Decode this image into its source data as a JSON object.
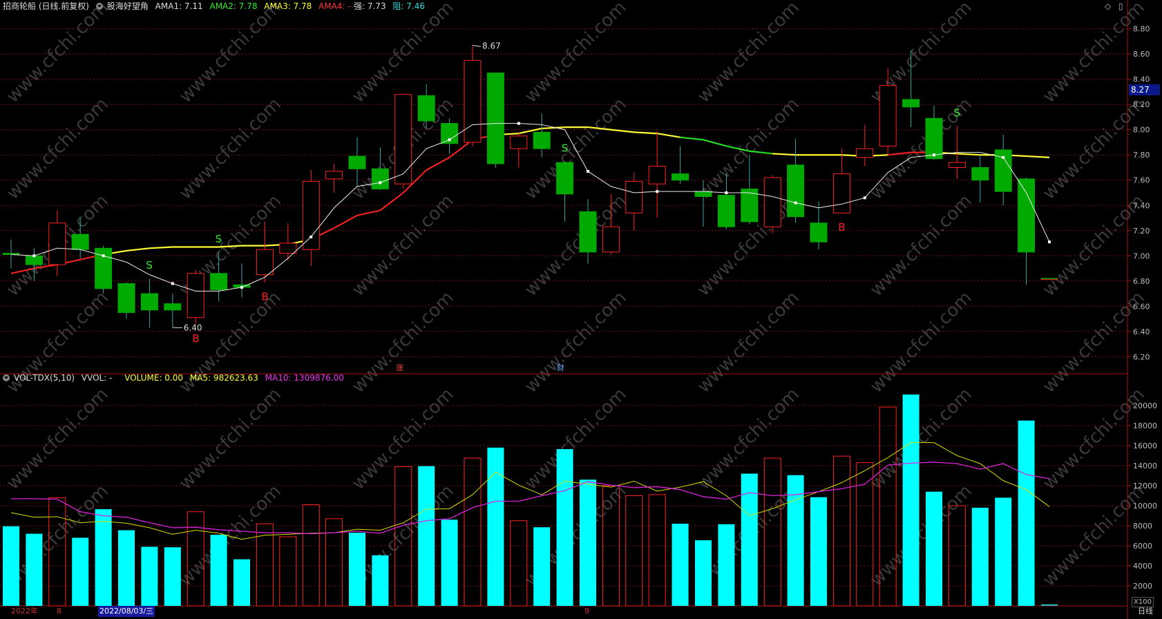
{
  "header": {
    "stock": "招商轮船 (日线.前复权)",
    "indicator": "股海好望角",
    "ama1": "AMA1: 7.11",
    "ama2": "AMA2: 7.78",
    "ama3": "AMA3: 7.78",
    "ama4": "AMA4: -",
    "strong": "强: 7.73",
    "resist": "阻: 7.46"
  },
  "vol_header": {
    "name": "VOL-TDX(5,10)",
    "vvol": "VVOL: -",
    "volume": "VOLUME: 0.00",
    "ma5": "MA5: 982623.63",
    "ma10": "MA10: 1309876.00"
  },
  "current_price_tag": "8.27",
  "high_label": "8.67",
  "low_label": "6.40",
  "markers": {
    "rise": "涨",
    "fin": "财"
  },
  "bottom": {
    "year": "2022年",
    "m8": "8",
    "date": "2022/08/03/三",
    "m9": "9",
    "daily": "日线",
    "unit": "X100"
  },
  "colors": {
    "up": "#ff2222",
    "down": "#00aa00",
    "ama_red": "#ee2222",
    "ama_green": "#22dd22",
    "ama_yellow": "#ffff33",
    "vol_up": "#00ffff",
    "ma5": "#dddd00",
    "ma10": "#dd22dd",
    "grid": "#771111",
    "axis": "#bbbbbb",
    "watermark": "#3a3a3a"
  },
  "watermark_text": "www.cfchi.com",
  "chart_data": [
    {
      "type": "candlestick",
      "y_ticks": [
        6.2,
        6.4,
        6.6,
        6.8,
        7.0,
        7.2,
        7.4,
        7.6,
        7.8,
        8.0,
        8.2,
        8.4,
        8.6,
        8.8
      ],
      "ylim": [
        6.07,
        8.93
      ],
      "candles": [
        {
          "o": 7.02,
          "h": 7.13,
          "l": 6.9,
          "c": 7.01
        },
        {
          "o": 7.0,
          "h": 7.06,
          "l": 6.8,
          "c": 6.93
        },
        {
          "o": 6.93,
          "h": 7.36,
          "l": 6.84,
          "c": 7.26
        },
        {
          "o": 7.17,
          "h": 7.3,
          "l": 6.98,
          "c": 7.05
        },
        {
          "o": 7.06,
          "h": 7.08,
          "l": 6.7,
          "c": 6.74
        },
        {
          "o": 6.78,
          "h": 6.79,
          "l": 6.5,
          "c": 6.55
        },
        {
          "o": 6.7,
          "h": 6.82,
          "l": 6.43,
          "c": 6.57
        },
        {
          "o": 6.62,
          "h": 6.7,
          "l": 6.43,
          "c": 6.57
        },
        {
          "o": 6.51,
          "h": 6.89,
          "l": 6.46,
          "c": 6.86
        },
        {
          "o": 6.86,
          "h": 7.03,
          "l": 6.64,
          "c": 6.73
        },
        {
          "o": 6.77,
          "h": 6.94,
          "l": 6.67,
          "c": 6.75
        },
        {
          "o": 6.85,
          "h": 7.27,
          "l": 6.79,
          "c": 7.05
        },
        {
          "o": 7.02,
          "h": 7.26,
          "l": 6.96,
          "c": 7.1
        },
        {
          "o": 7.05,
          "h": 7.68,
          "l": 6.92,
          "c": 7.59
        },
        {
          "o": 7.61,
          "h": 7.73,
          "l": 7.5,
          "c": 7.67
        },
        {
          "o": 7.79,
          "h": 7.94,
          "l": 7.55,
          "c": 7.69
        },
        {
          "o": 7.69,
          "h": 7.86,
          "l": 7.52,
          "c": 7.53
        },
        {
          "o": 7.57,
          "h": 8.28,
          "l": 7.53,
          "c": 8.28
        },
        {
          "o": 8.27,
          "h": 8.36,
          "l": 8.01,
          "c": 8.07
        },
        {
          "o": 8.05,
          "h": 8.09,
          "l": 7.81,
          "c": 7.89
        },
        {
          "o": 7.9,
          "h": 8.67,
          "l": 7.87,
          "c": 8.55
        },
        {
          "o": 8.45,
          "h": 8.45,
          "l": 7.7,
          "c": 7.73
        },
        {
          "o": 7.85,
          "h": 7.98,
          "l": 7.7,
          "c": 7.95
        },
        {
          "o": 7.98,
          "h": 8.13,
          "l": 7.78,
          "c": 7.85
        },
        {
          "o": 7.74,
          "h": 7.75,
          "l": 7.27,
          "c": 7.49
        },
        {
          "o": 7.35,
          "h": 7.45,
          "l": 6.94,
          "c": 7.03
        },
        {
          "o": 7.03,
          "h": 7.49,
          "l": 7.01,
          "c": 7.23
        },
        {
          "o": 7.34,
          "h": 7.66,
          "l": 7.2,
          "c": 7.59
        },
        {
          "o": 7.57,
          "h": 7.99,
          "l": 7.3,
          "c": 7.71
        },
        {
          "o": 7.65,
          "h": 7.87,
          "l": 7.57,
          "c": 7.6
        },
        {
          "o": 7.51,
          "h": 7.6,
          "l": 7.23,
          "c": 7.47
        },
        {
          "o": 7.48,
          "h": 7.65,
          "l": 7.21,
          "c": 7.23
        },
        {
          "o": 7.53,
          "h": 7.8,
          "l": 7.25,
          "c": 7.27
        },
        {
          "o": 7.23,
          "h": 7.64,
          "l": 7.18,
          "c": 7.62
        },
        {
          "o": 7.72,
          "h": 7.93,
          "l": 7.26,
          "c": 7.31
        },
        {
          "o": 7.26,
          "h": 7.43,
          "l": 7.05,
          "c": 7.11
        },
        {
          "o": 7.34,
          "h": 7.85,
          "l": 7.34,
          "c": 7.65
        },
        {
          "o": 7.78,
          "h": 8.04,
          "l": 7.71,
          "c": 7.85
        },
        {
          "o": 7.87,
          "h": 8.49,
          "l": 7.8,
          "c": 8.35
        },
        {
          "o": 8.24,
          "h": 8.63,
          "l": 8.02,
          "c": 8.18
        },
        {
          "o": 8.09,
          "h": 8.19,
          "l": 7.76,
          "c": 7.77
        },
        {
          "o": 7.7,
          "h": 8.03,
          "l": 7.61,
          "c": 7.74
        },
        {
          "o": 7.7,
          "h": 7.8,
          "l": 7.42,
          "c": 7.6
        },
        {
          "o": 7.84,
          "h": 7.96,
          "l": 7.4,
          "c": 7.51
        },
        {
          "o": 7.61,
          "h": 7.62,
          "l": 6.77,
          "c": 7.03
        },
        {
          "o": 6.82,
          "h": 6.82,
          "l": 6.82,
          "c": 6.82
        }
      ],
      "ama_white": [
        7.01,
        7.0,
        7.06,
        7.05,
        7.0,
        6.95,
        6.85,
        6.78,
        6.72,
        6.72,
        6.75,
        6.83,
        6.98,
        7.15,
        7.38,
        7.55,
        7.58,
        7.65,
        7.85,
        7.92,
        8.04,
        8.05,
        8.05,
        8.04,
        8.0,
        7.67,
        7.55,
        7.5,
        7.51,
        7.51,
        7.51,
        7.5,
        7.5,
        7.47,
        7.42,
        7.38,
        7.41,
        7.46,
        7.66,
        7.78,
        7.8,
        7.82,
        7.82,
        7.78,
        7.5,
        7.11
      ],
      "ama_trend": {
        "values": [
          6.86,
          6.9,
          6.93,
          6.97,
          7.01,
          7.04,
          7.06,
          7.07,
          7.07,
          7.07,
          7.08,
          7.08,
          7.09,
          7.13,
          7.22,
          7.32,
          7.36,
          7.5,
          7.68,
          7.78,
          7.92,
          7.96,
          7.97,
          8.01,
          8.02,
          8.02,
          8.0,
          7.98,
          7.97,
          7.94,
          7.92,
          7.87,
          7.83,
          7.81,
          7.8,
          7.8,
          7.8,
          7.79,
          7.8,
          7.82,
          7.82,
          7.81,
          7.8,
          7.8,
          7.79,
          7.78
        ],
        "colors": [
          "r",
          "r",
          "r",
          "r",
          "y",
          "y",
          "y",
          "y",
          "y",
          "y",
          "y",
          "y",
          "y",
          "r",
          "r",
          "r",
          "r",
          "r",
          "r",
          "r",
          "r",
          "y",
          "y",
          "y",
          "y",
          "y",
          "y",
          "y",
          "y",
          "g",
          "g",
          "g",
          "g",
          "y",
          "y",
          "y",
          "y",
          "y",
          "r",
          "r",
          "y",
          "y",
          "y",
          "y",
          "y",
          "y"
        ]
      },
      "signals": [
        {
          "i": 6,
          "t": "S",
          "v": "above"
        },
        {
          "i": 9,
          "t": "S",
          "v": "above"
        },
        {
          "i": 8,
          "t": "B",
          "v": "below"
        },
        {
          "i": 11,
          "t": "B",
          "v": "below"
        },
        {
          "i": 24,
          "t": "S",
          "v": "above"
        },
        {
          "i": 36,
          "t": "B",
          "v": "below"
        },
        {
          "i": 41,
          "t": "S",
          "v": "above"
        }
      ]
    },
    {
      "type": "bar",
      "y_ticks": [
        2000,
        4000,
        6000,
        8000,
        10000,
        12000,
        14000,
        16000,
        18000,
        20000
      ],
      "ylim": [
        0,
        22000
      ],
      "volumes": [
        7950,
        7200,
        10800,
        6800,
        9650,
        7550,
        5900,
        5850,
        9400,
        7100,
        4650,
        8200,
        6900,
        10100,
        8700,
        7300,
        5050,
        13900,
        13950,
        8600,
        14750,
        15800,
        8500,
        7850,
        15650,
        12600,
        12000,
        11000,
        11100,
        8200,
        6550,
        8150,
        13200,
        14750,
        13050,
        10850,
        14950,
        14300,
        19850,
        21100,
        11400,
        10000,
        9800,
        10800,
        18500,
        200
      ],
      "ma5": [
        9300,
        8850,
        8900,
        8300,
        8450,
        8250,
        7800,
        7150,
        7550,
        7250,
        6650,
        7050,
        7150,
        7250,
        7300,
        7650,
        7550,
        8300,
        9650,
        9700,
        11100,
        13350,
        12050,
        11100,
        12450,
        12150,
        11850,
        12450,
        11450,
        11850,
        12400,
        11000,
        9000,
        9700,
        10600,
        11400,
        12300,
        13500,
        14800,
        16300,
        16300,
        15000,
        14200,
        12500,
        11600,
        9900
      ],
      "ma10": [
        10700,
        10700,
        10650,
        9400,
        9000,
        8850,
        8300,
        7800,
        7850,
        7600,
        7450,
        7300,
        7300,
        7200,
        7300,
        7450,
        7250,
        8050,
        8500,
        8700,
        9800,
        10450,
        10450,
        11000,
        11500,
        12400,
        12050,
        11800,
        11900,
        11600,
        10900,
        10650,
        11300,
        11000,
        11100,
        11400,
        11700,
        12150,
        14050,
        14250,
        14350,
        14200,
        13650,
        14200,
        13100,
        12700
      ]
    }
  ]
}
